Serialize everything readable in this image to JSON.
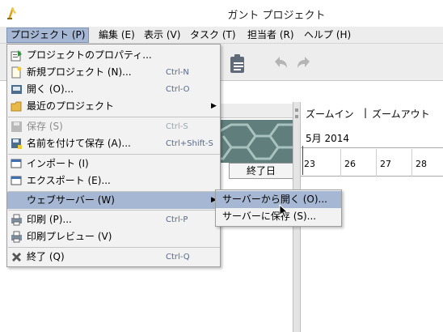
{
  "window": {
    "title": "ガント プロジェクト"
  },
  "menubar": {
    "items": [
      {
        "label": "プロジェクト (P)",
        "active": true
      },
      {
        "label": "編集 (E)"
      },
      {
        "label": "表示 (V)"
      },
      {
        "label": "タスク (T)"
      },
      {
        "label": "担当者 (R)"
      },
      {
        "label": "ヘルプ (H)"
      }
    ]
  },
  "project_menu": {
    "items": [
      {
        "label": "プロジェクトのプロパティ...",
        "icon": "properties-icon"
      },
      {
        "label": "新規プロジェクト (N)...",
        "accel": "Ctrl-N",
        "icon": "new-document-icon"
      },
      {
        "label": "開く (O)...",
        "accel": "Ctrl-O",
        "icon": "open-icon"
      },
      {
        "label": "最近のプロジェクト",
        "icon": "folder-icon",
        "submenu": true
      },
      {
        "label": "保存 (S)",
        "accel": "Ctrl-S",
        "icon": "save-icon",
        "disabled": true
      },
      {
        "label": "名前を付けて保存 (A)...",
        "accel": "Ctrl+Shift-S",
        "icon": "save-as-icon"
      },
      {
        "label": "インポート (I)",
        "icon": "import-icon"
      },
      {
        "label": "エクスポート (E)...",
        "icon": "export-icon"
      },
      {
        "label": "ウェブサーバー (W)",
        "submenu": true,
        "highlighted": true
      },
      {
        "label": "印刷 (P)...",
        "accel": "Ctrl-P",
        "icon": "print-icon"
      },
      {
        "label": "印刷プレビュー (V)",
        "icon": "print-preview-icon"
      },
      {
        "label": "終了 (Q)",
        "accel": "Ctrl-Q",
        "icon": "exit-icon"
      }
    ]
  },
  "webserver_submenu": {
    "items": [
      {
        "label": "サーバーから開く (O)...",
        "highlighted": true
      },
      {
        "label": "サーバーに保存 (S)..."
      }
    ]
  },
  "task_table": {
    "end_column": "終了日"
  },
  "gantt": {
    "zoom_in": "ズームイン",
    "separator": "|",
    "zoom_out": "ズームアウト",
    "month": "5月 2014",
    "days": [
      "23",
      "26",
      "27",
      "28"
    ]
  },
  "colors": {
    "menu_highlight": "#a6b7d3",
    "menu_bg": "#f2f2f2",
    "accel_text": "#566a8a"
  }
}
